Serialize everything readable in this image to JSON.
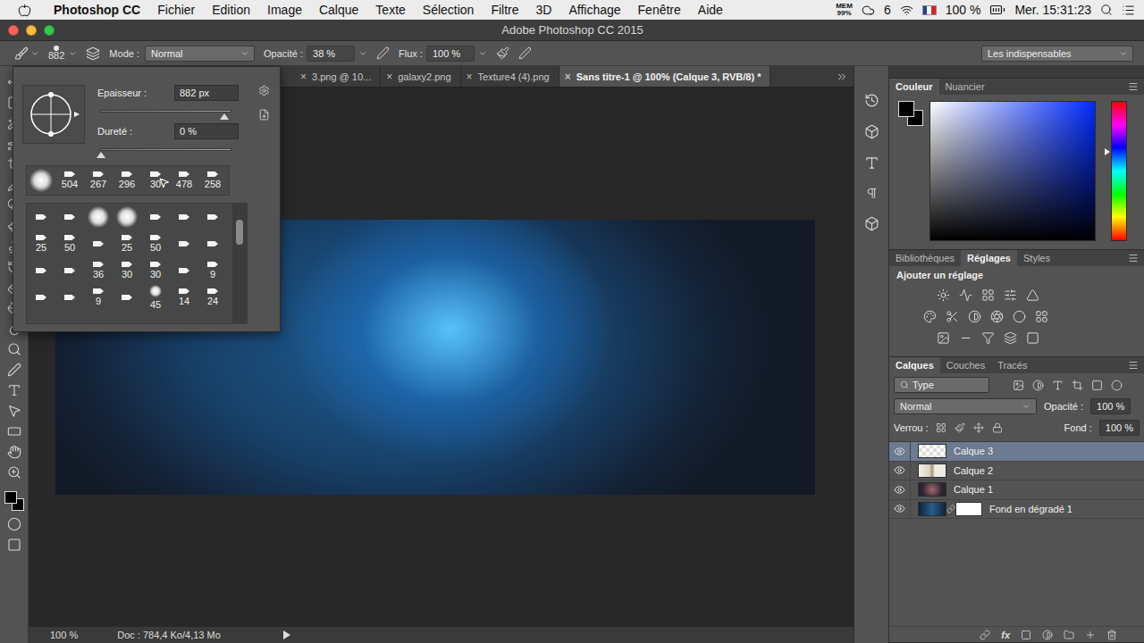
{
  "menubar": {
    "app": "Photoshop CC",
    "items": [
      "Fichier",
      "Edition",
      "Image",
      "Calque",
      "Texte",
      "Sélection",
      "Filtre",
      "3D",
      "Affichage",
      "Fenêtre",
      "Aide"
    ],
    "status": {
      "memory_label": "MEM",
      "memory": "99%",
      "cc_count": "6",
      "battery": "100 %",
      "clock": "Mer. 15:31:23"
    }
  },
  "window": {
    "title": "Adobe Photoshop CC 2015"
  },
  "options_bar": {
    "brush_size": "882",
    "mode_label": "Mode :",
    "mode": "Normal",
    "opacity_label": "Opacité :",
    "opacity": "38 %",
    "flow_label": "Flux :",
    "flow": "100 %",
    "workspace": "Les indispensables"
  },
  "brush_picker": {
    "size_label": "Epaisseur :",
    "size": "882 px",
    "size_level": 0.95,
    "hardness_label": "Dureté :",
    "hardness": "0 %",
    "hardness_level": 0,
    "recent": [
      {
        "label": "",
        "kind": "soft",
        "hovered": false
      },
      {
        "label": "504",
        "kind": "tip",
        "hovered": false
      },
      {
        "label": "267",
        "kind": "tip",
        "hovered": false
      },
      {
        "label": "296",
        "kind": "tip",
        "hovered": false
      },
      {
        "label": "30",
        "kind": "tip",
        "hovered": true
      },
      {
        "label": "478",
        "kind": "tip",
        "hovered": false
      },
      {
        "label": "258",
        "kind": "tip",
        "hovered": false
      }
    ],
    "presets": [
      {
        "label": "",
        "kind": "tip"
      },
      {
        "label": "",
        "kind": "tip"
      },
      {
        "label": "",
        "kind": "soft"
      },
      {
        "label": "",
        "kind": "soft"
      },
      {
        "label": "",
        "kind": "tip"
      },
      {
        "label": "",
        "kind": "tip"
      },
      {
        "label": "",
        "kind": "tip"
      },
      {
        "label": "25",
        "kind": "tip"
      },
      {
        "label": "50",
        "kind": "tip"
      },
      {
        "label": "",
        "kind": "tip"
      },
      {
        "label": "25",
        "kind": "tip"
      },
      {
        "label": "50",
        "kind": "tip"
      },
      {
        "label": "",
        "kind": "tip"
      },
      {
        "label": "",
        "kind": "tip"
      },
      {
        "label": "",
        "kind": "tip"
      },
      {
        "label": "",
        "kind": "tip"
      },
      {
        "label": "36",
        "kind": "tip"
      },
      {
        "label": "30",
        "kind": "tip"
      },
      {
        "label": "30",
        "kind": "tip"
      },
      {
        "label": "",
        "kind": "tip"
      },
      {
        "label": "9",
        "kind": "tip"
      },
      {
        "label": "",
        "kind": "tip"
      },
      {
        "label": "",
        "kind": "tip"
      },
      {
        "label": "9",
        "kind": "tip"
      },
      {
        "label": "",
        "kind": "tip"
      },
      {
        "label": "45",
        "kind": "soft"
      },
      {
        "label": "14",
        "kind": "tip"
      },
      {
        "label": "24",
        "kind": "tip"
      }
    ]
  },
  "doc_tabs": [
    {
      "label": "3.png @ 10...",
      "close": "×",
      "selected": false
    },
    {
      "label": "galaxy2.png",
      "close": "×",
      "selected": false
    },
    {
      "label": "Texture4 (4).png",
      "close": "×",
      "selected": false
    },
    {
      "label": "Sans titre-1 @ 100% (Calque 3, RVB/8) *",
      "close": "×",
      "selected": true
    }
  ],
  "swatches": [
    {
      "kind": "foreground",
      "color": "#000000"
    },
    {
      "kind": "background",
      "color": "#000000"
    }
  ],
  "color_panel": {
    "tabs": [
      {
        "label": "Couleur",
        "selected": true
      },
      {
        "label": "Nuancier",
        "selected": false
      }
    ],
    "hue_level": 0.36
  },
  "adjustments_panel": {
    "tabs": [
      {
        "label": "Bibliothèques",
        "selected": false
      },
      {
        "label": "Réglages",
        "selected": true
      },
      {
        "label": "Styles",
        "selected": false
      }
    ],
    "heading": "Ajouter un réglage"
  },
  "layers_panel": {
    "tabs": [
      {
        "label": "Calques",
        "selected": true
      },
      {
        "label": "Couches",
        "selected": false
      },
      {
        "label": "Tracés",
        "selected": false
      }
    ],
    "filter": "Type",
    "blend_mode": "Normal",
    "opacity_label": "Opacité :",
    "opacity": "100 %",
    "lock_label": "Verrou :",
    "fill_label": "Fond :",
    "fill": "100 %",
    "layers": [
      {
        "name": "Calque 3",
        "kind": "transparent",
        "visible": true,
        "selected": true
      },
      {
        "name": "Calque 2",
        "kind": "image",
        "visible": true,
        "selected": false
      },
      {
        "name": "Calque 1",
        "kind": "photo",
        "visible": true,
        "selected": false
      },
      {
        "name": "Fond en dégradé 1",
        "kind": "fill",
        "visible": true,
        "selected": false
      }
    ],
    "fx_label": "fx"
  },
  "status_bar": {
    "zoom": "100 %",
    "doc": "Doc : 784,4 Ko/4,13 Mo"
  }
}
